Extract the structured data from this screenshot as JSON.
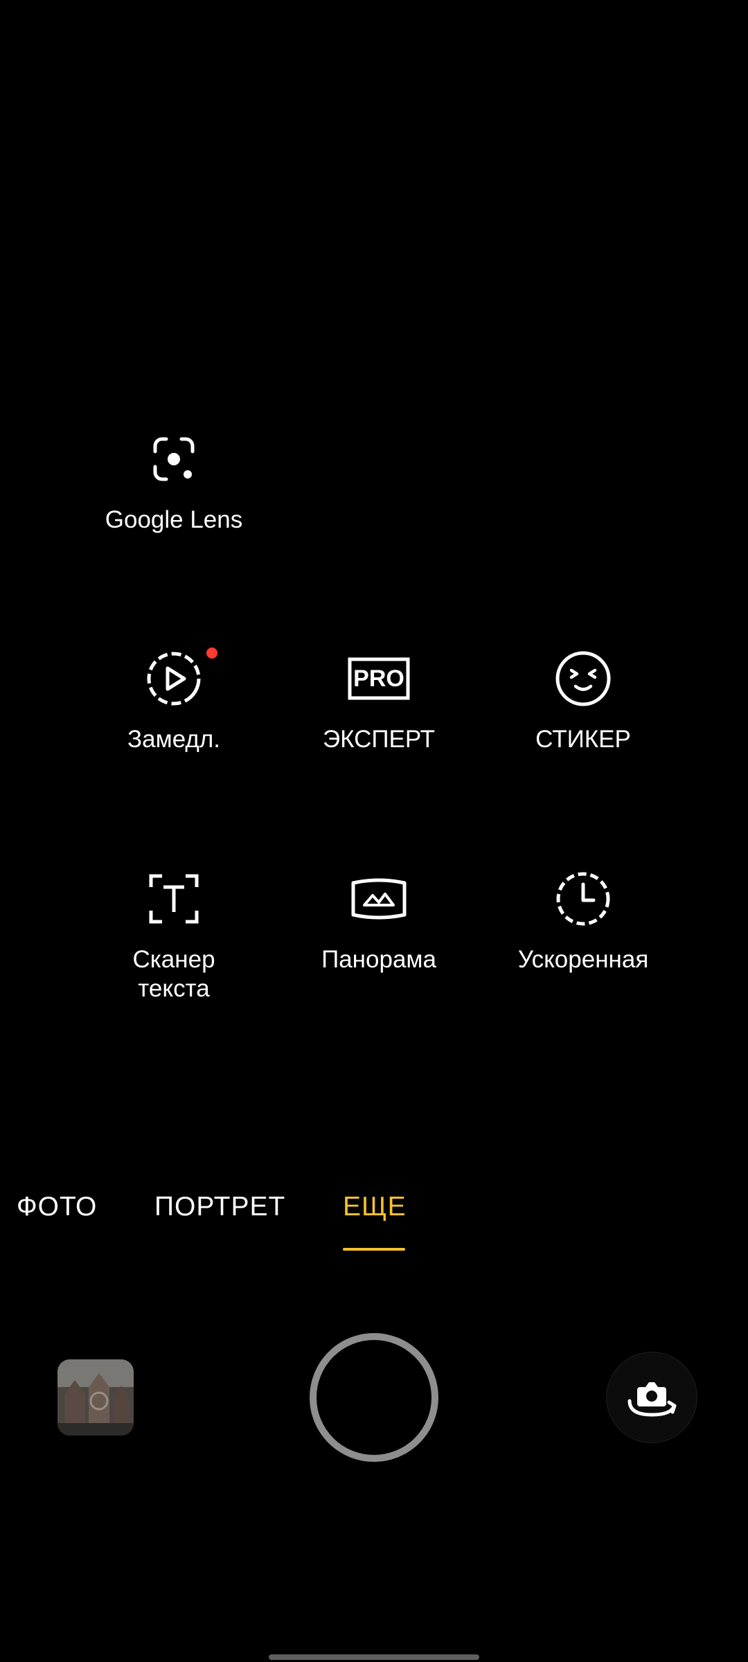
{
  "modes": {
    "google_lens": {
      "label": "Google Lens",
      "icon": "google-lens-icon"
    },
    "slow_motion": {
      "label": "Замедл.",
      "icon": "slow-motion-icon",
      "has_new_badge": true
    },
    "expert": {
      "label": "ЭКСПЕРТ",
      "icon": "pro-icon",
      "icon_text": "PRO"
    },
    "sticker": {
      "label": "СТИКЕР",
      "icon": "sticker-face-icon"
    },
    "text_scanner": {
      "label": "Сканер\nтекста",
      "icon": "text-scan-icon"
    },
    "panorama": {
      "label": "Панорама",
      "icon": "panorama-icon"
    },
    "timelapse": {
      "label": "Ускоренная",
      "icon": "timelapse-icon"
    }
  },
  "mode_tabs": [
    {
      "label": "ФОТО",
      "active": false
    },
    {
      "label": "ПОРТРЕТ",
      "active": false
    },
    {
      "label": "ЕЩЕ",
      "active": true
    }
  ],
  "controls": {
    "gallery_thumbnail": "gallery-thumbnail",
    "shutter": "shutter-button",
    "switch_camera": "switch-camera-icon"
  },
  "colors": {
    "background": "#000000",
    "accent": "#f6c12f",
    "badge": "#ff3b30",
    "shutter_ring": "#8e8e8e"
  }
}
